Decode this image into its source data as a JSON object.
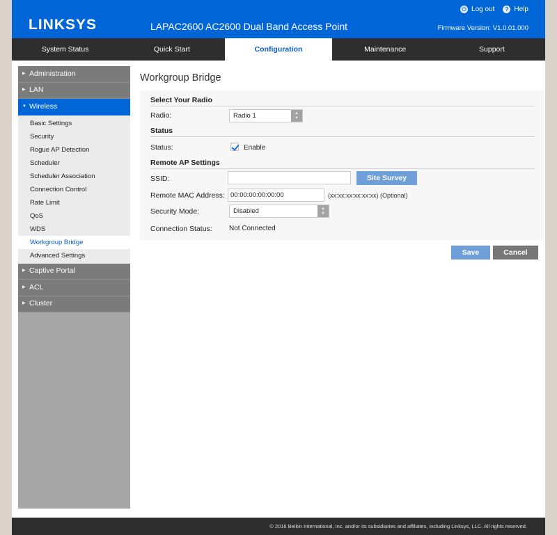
{
  "header": {
    "logo": "LINKSYS",
    "product_title": "LAPAC2600 AC2600 Dual Band Access Point",
    "logout_label": "Log out",
    "help_label": "Help",
    "firmware": "Firmware Version: V1.0.01.000",
    "brand_color": "#0066d8"
  },
  "tabs": [
    {
      "label": "System Status",
      "active": false
    },
    {
      "label": "Quick Start",
      "active": false
    },
    {
      "label": "Configuration",
      "active": true
    },
    {
      "label": "Maintenance",
      "active": false
    },
    {
      "label": "Support",
      "active": false
    }
  ],
  "sidebar": {
    "groups_top": [
      {
        "label": "Administration"
      },
      {
        "label": "LAN"
      },
      {
        "label": "Wireless",
        "expanded": true
      }
    ],
    "wireless_items": [
      {
        "label": "Basic Settings"
      },
      {
        "label": "Security"
      },
      {
        "label": "Rogue AP Detection"
      },
      {
        "label": "Scheduler"
      },
      {
        "label": "Scheduler Association"
      },
      {
        "label": "Connection Control"
      },
      {
        "label": "Rate Limit"
      },
      {
        "label": "QoS"
      },
      {
        "label": "WDS"
      },
      {
        "label": "Workgroup Bridge",
        "active": true
      },
      {
        "label": "Advanced Settings"
      }
    ],
    "groups_bottom": [
      {
        "label": "Captive Portal"
      },
      {
        "label": "ACL"
      },
      {
        "label": "Cluster"
      }
    ]
  },
  "main": {
    "title": "Workgroup Bridge",
    "select_radio": {
      "section_title": "Select Your Radio",
      "radio_label": "Radio:",
      "radio_value": "Radio 1"
    },
    "status": {
      "section_title": "Status",
      "status_label": "Status:",
      "enable_label": "Enable",
      "enabled": true
    },
    "remote_ap": {
      "section_title": "Remote AP Settings",
      "ssid_label": "SSID:",
      "ssid_value": "",
      "site_survey_label": "Site Survey",
      "mac_label": "Remote MAC Address:",
      "mac_value": "00:00:00:00:00:00",
      "mac_hint": "(xx:xx:xx:xx:xx:xx) (Optional)",
      "security_label": "Security Mode:",
      "security_value": "Disabled",
      "connection_label": "Connection Status:",
      "connection_value": "Not Connected"
    },
    "save_label": "Save",
    "cancel_label": "Cancel"
  },
  "footer": {
    "copyright": "© 2016 Belkin International, Inc. and/or its subsidiaries and affiliates, including Linksys, LLC. All rights reserved."
  }
}
